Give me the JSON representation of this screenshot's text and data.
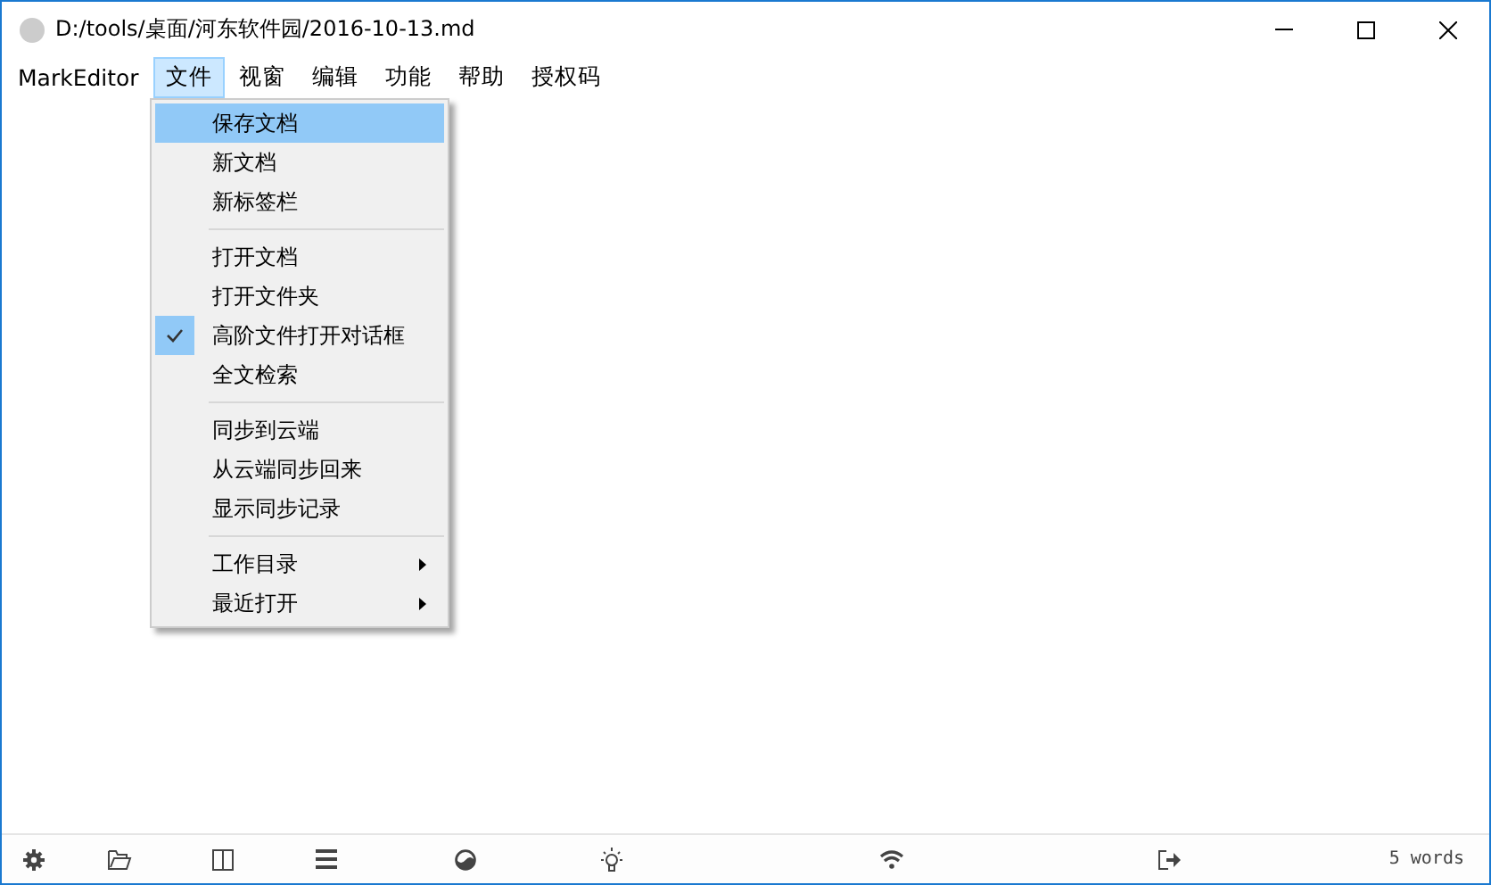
{
  "window": {
    "title": "D:/tools/桌面/河东软件园/2016-10-13.md"
  },
  "menu_bar": [
    {
      "label": "MarkEditor",
      "selected": false
    },
    {
      "label": "文件",
      "selected": true
    },
    {
      "label": "视窗",
      "selected": false
    },
    {
      "label": "编辑",
      "selected": false
    },
    {
      "label": "功能",
      "selected": false
    },
    {
      "label": "帮助",
      "selected": false
    },
    {
      "label": "授权码",
      "selected": false
    }
  ],
  "file_menu": {
    "groups": [
      [
        {
          "label": "保存文档",
          "selected": true,
          "checked": false,
          "submenu": false
        },
        {
          "label": "新文档",
          "selected": false,
          "checked": false,
          "submenu": false
        },
        {
          "label": "新标签栏",
          "selected": false,
          "checked": false,
          "submenu": false
        }
      ],
      [
        {
          "label": "打开文档",
          "selected": false,
          "checked": false,
          "submenu": false
        },
        {
          "label": "打开文件夹",
          "selected": false,
          "checked": false,
          "submenu": false
        },
        {
          "label": "高阶文件打开对话框",
          "selected": false,
          "checked": true,
          "submenu": false
        },
        {
          "label": "全文检索",
          "selected": false,
          "checked": false,
          "submenu": false
        }
      ],
      [
        {
          "label": "同步到云端",
          "selected": false,
          "checked": false,
          "submenu": false
        },
        {
          "label": "从云端同步回来",
          "selected": false,
          "checked": false,
          "submenu": false
        },
        {
          "label": "显示同步记录",
          "selected": false,
          "checked": false,
          "submenu": false
        }
      ],
      [
        {
          "label": "工作目录",
          "selected": false,
          "checked": false,
          "submenu": true
        },
        {
          "label": "最近打开",
          "selected": false,
          "checked": false,
          "submenu": true
        }
      ]
    ]
  },
  "status_bar": {
    "tools": [
      {
        "kind": "settings"
      },
      {
        "kind": "folder"
      },
      {
        "kind": "columns"
      },
      {
        "kind": "menu"
      },
      {
        "kind": "theme"
      },
      {
        "kind": "bulb"
      },
      {
        "kind": "wifi"
      },
      {
        "kind": "export"
      }
    ],
    "word_count": "5 words"
  }
}
